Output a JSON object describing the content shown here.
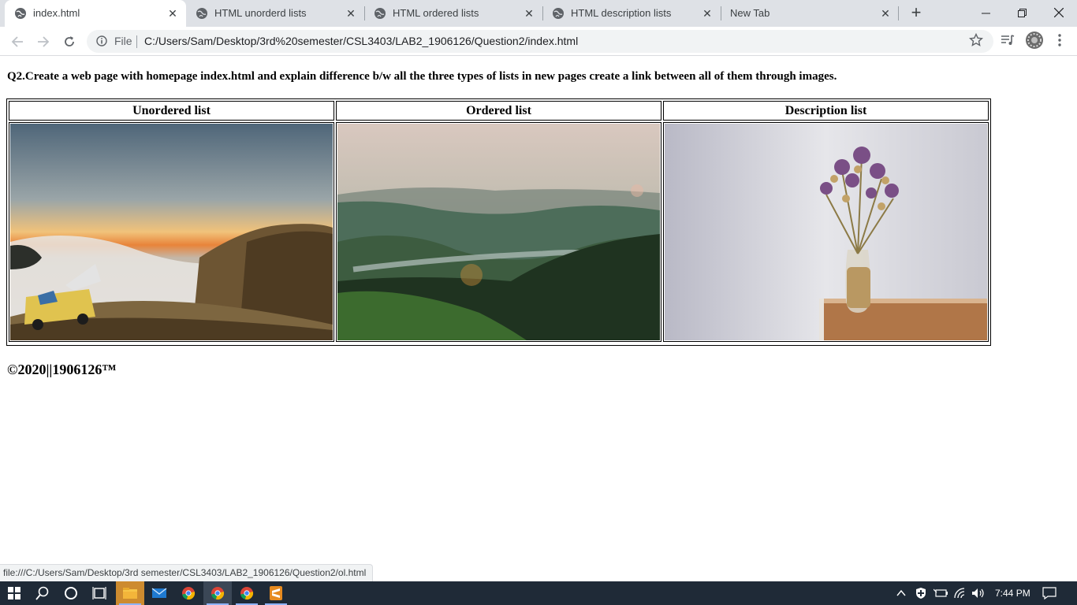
{
  "browser": {
    "tabs": [
      {
        "title": "index.html",
        "active": true
      },
      {
        "title": "HTML unorderd lists",
        "active": false
      },
      {
        "title": "HTML ordered lists",
        "active": false
      },
      {
        "title": "HTML description lists",
        "active": false
      },
      {
        "title": "New Tab",
        "active": false
      }
    ],
    "omnibox": {
      "scheme_label": "File",
      "url": "C:/Users/Sam/Desktop/3rd%20semester/CSL3403/LAB2_1906126/Question2/index.html"
    },
    "status_url": "file:///C:/Users/Sam/Desktop/3rd semester/CSL3403/LAB2_1906126/Question2/ol.html"
  },
  "page": {
    "question": "Q2.Create a web page with homepage index.html and explain difference b/w all the three types of lists in new pages create a link between all of them through images.",
    "columns": [
      {
        "heading": "Unordered list",
        "image": "sunset-campervan-over-clouds"
      },
      {
        "heading": "Ordered list",
        "image": "green-valley-landscape"
      },
      {
        "heading": "Description list",
        "image": "dried-flowers-in-vase"
      }
    ],
    "footer": "©2020||1906126™"
  },
  "taskbar": {
    "apps": [
      "windows-start-icon",
      "search-icon",
      "cortana-icon",
      "task-view-icon",
      "file-explorer-icon",
      "mail-icon",
      "chrome-icon",
      "chrome-icon",
      "chrome-icon",
      "sublime-text-icon"
    ],
    "clock": "7:44 PM"
  }
}
